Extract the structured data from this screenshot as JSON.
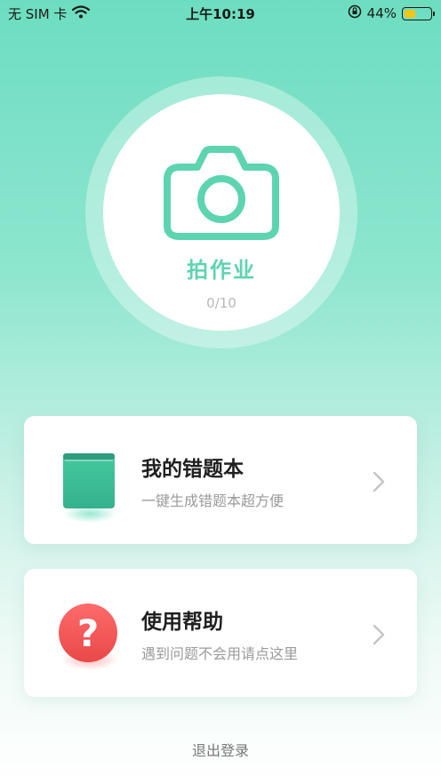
{
  "status_bar": {
    "carrier": "无 SIM 卡",
    "time": "上午10:19",
    "battery_percent": "44%",
    "battery_level": 0.44
  },
  "camera": {
    "label": "拍作业",
    "count": "0/10"
  },
  "cards": [
    {
      "title": "我的错题本",
      "subtitle": "一键生成错题本超方便",
      "icon": "book-icon"
    },
    {
      "title": "使用帮助",
      "subtitle": "遇到问题不会用请点这里",
      "icon": "question-icon"
    }
  ],
  "logout_label": "退出登录",
  "colors": {
    "accent": "#5dd4b0",
    "help_red": "#f2585a"
  }
}
